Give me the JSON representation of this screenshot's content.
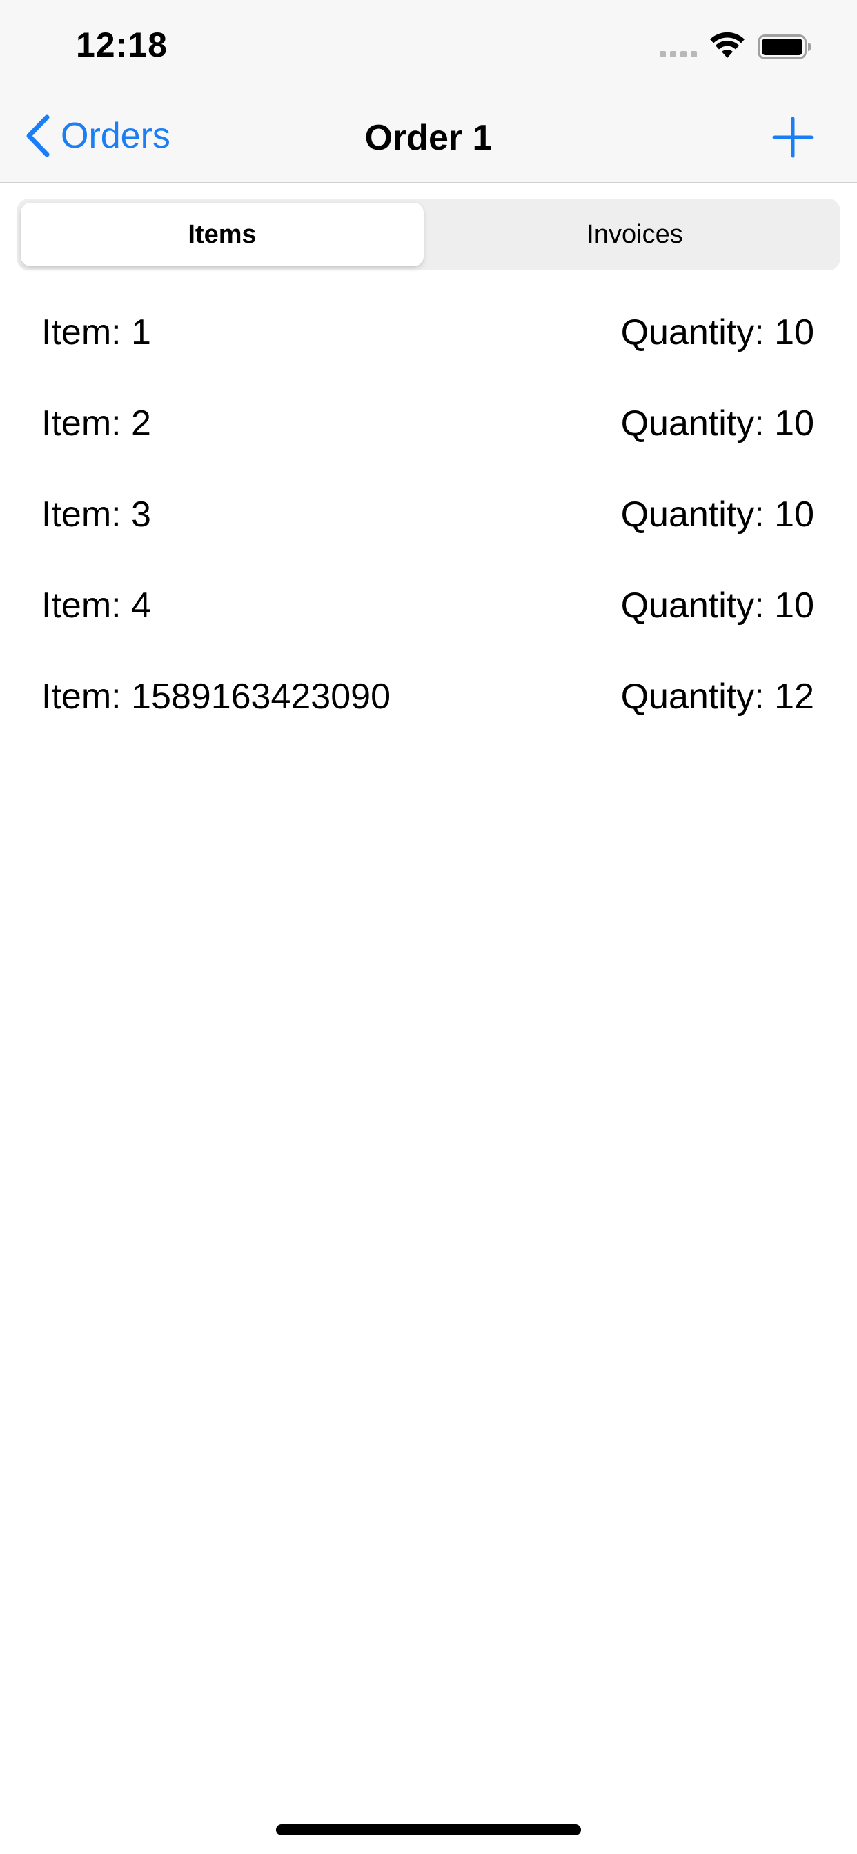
{
  "status_bar": {
    "time": "12:18"
  },
  "nav": {
    "back_label": "Orders",
    "title": "Order 1",
    "accent_color": "#1a7ef5"
  },
  "segments": [
    {
      "label": "Items",
      "selected": true
    },
    {
      "label": "Invoices",
      "selected": false
    }
  ],
  "items": [
    {
      "name": "Item: 1",
      "quantity": "Quantity: 10"
    },
    {
      "name": "Item: 2",
      "quantity": "Quantity: 10"
    },
    {
      "name": "Item: 3",
      "quantity": "Quantity: 10"
    },
    {
      "name": "Item: 4",
      "quantity": "Quantity: 10"
    },
    {
      "name": "Item: 1589163423090",
      "quantity": "Quantity: 12"
    }
  ],
  "icons": {
    "back": "chevron-left-icon",
    "add": "plus-icon",
    "wifi": "wifi-icon",
    "battery": "battery-icon",
    "signal": "cellular-signal-icon"
  }
}
